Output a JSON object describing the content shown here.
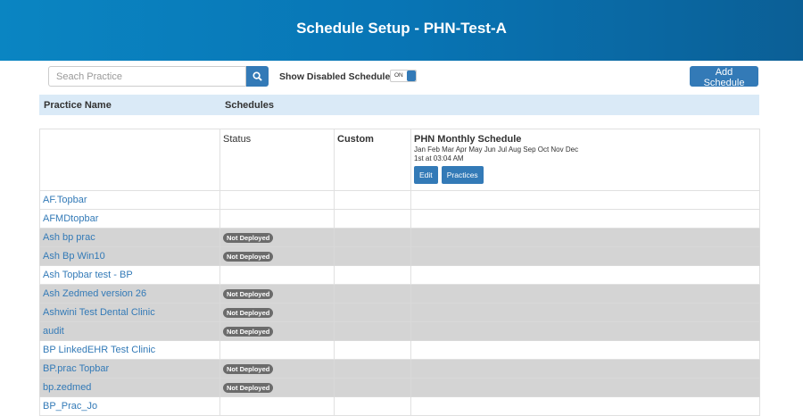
{
  "header": {
    "title": "Schedule Setup - PHN-Test-A"
  },
  "toolbar": {
    "search_placeholder": "Seach Practice",
    "show_disabled_label": "Show Disabled Schedules",
    "toggle_state": "ON",
    "add_label": "Add Schedule"
  },
  "columns": {
    "practice": "Practice Name",
    "schedules": "Schedules"
  },
  "grid_header": {
    "status": "Status",
    "custom": "Custom",
    "schedule_title": "PHN Monthly Schedule",
    "schedule_months": "Jan Feb Mar Apr May Jun Jul Aug Sep Oct Nov Dec",
    "schedule_time": "1st at 03:04 AM",
    "edit_label": "Edit",
    "practices_label": "Practices"
  },
  "rows": [
    {
      "name": "AF.Topbar",
      "status": "",
      "disabled": false
    },
    {
      "name": "AFMDtopbar",
      "status": "",
      "disabled": false
    },
    {
      "name": "Ash bp prac",
      "status": "Not Deployed",
      "disabled": true
    },
    {
      "name": "Ash Bp Win10",
      "status": "Not Deployed",
      "disabled": true
    },
    {
      "name": "Ash Topbar test - BP",
      "status": "",
      "disabled": false
    },
    {
      "name": "Ash Zedmed version 26",
      "status": "Not Deployed",
      "disabled": true
    },
    {
      "name": "Ashwini Test Dental Clinic",
      "status": "Not Deployed",
      "disabled": true
    },
    {
      "name": "audit",
      "status": "Not Deployed",
      "disabled": true
    },
    {
      "name": "BP LinkedEHR Test Clinic",
      "status": "",
      "disabled": false
    },
    {
      "name": "BP.prac Topbar",
      "status": "Not Deployed",
      "disabled": true
    },
    {
      "name": "bp.zedmed",
      "status": "Not Deployed",
      "disabled": true
    },
    {
      "name": "BP_Prac_Jo",
      "status": "",
      "disabled": false
    }
  ]
}
